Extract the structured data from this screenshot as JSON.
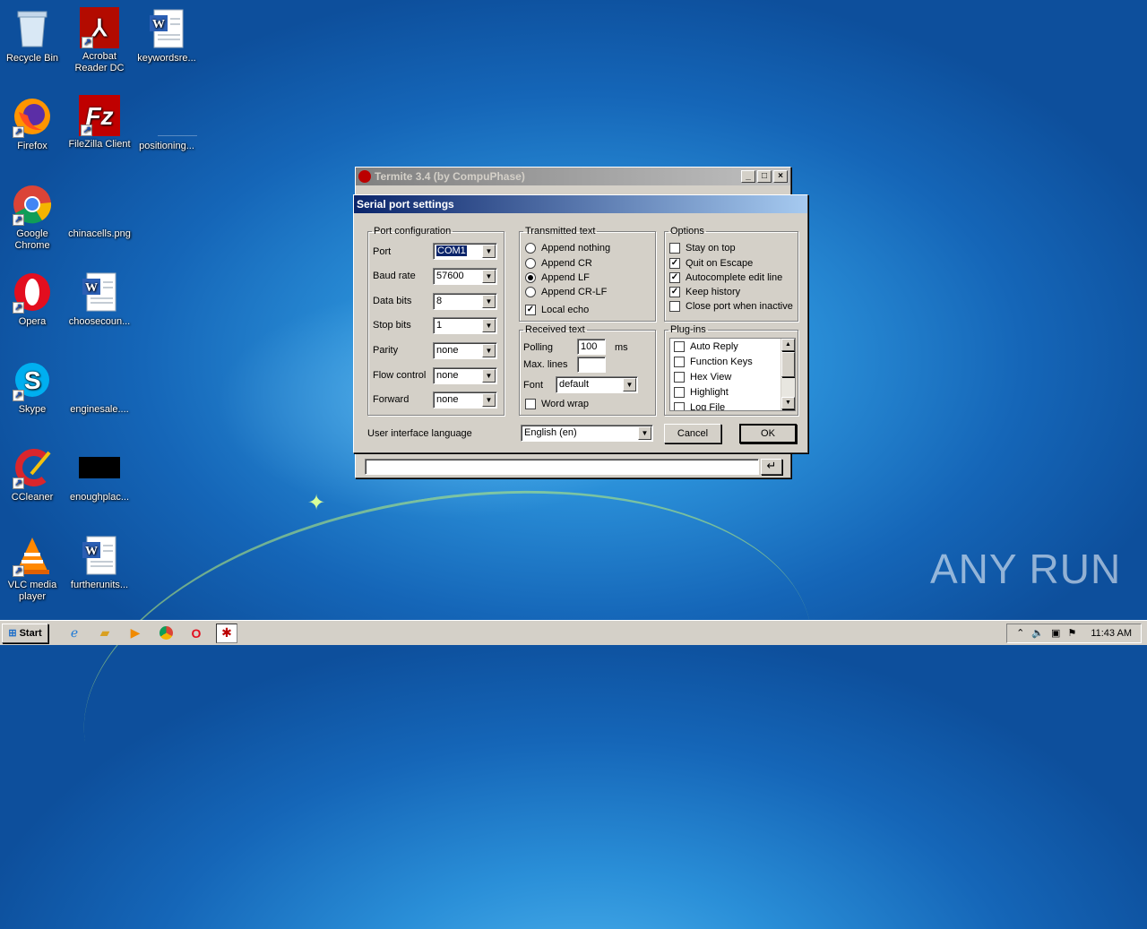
{
  "desktop_icons": [
    {
      "label": "Recycle Bin",
      "icon": "recycle-bin-icon"
    },
    {
      "label": "Acrobat Reader DC",
      "icon": "acrobat-icon"
    },
    {
      "label": "keywordsre...",
      "icon": "word-doc-icon"
    },
    {
      "label": "Firefox",
      "icon": "firefox-icon"
    },
    {
      "label": "FileZilla Client",
      "icon": "filezilla-icon"
    },
    {
      "label": "positioning...",
      "icon": "file-icon"
    },
    {
      "label": "Google Chrome",
      "icon": "chrome-icon"
    },
    {
      "label": "chinacells.png",
      "icon": "image-file-icon"
    },
    {
      "label": "Opera",
      "icon": "opera-icon"
    },
    {
      "label": "choosecoun...",
      "icon": "word-doc-icon"
    },
    {
      "label": "Skype",
      "icon": "skype-icon"
    },
    {
      "label": "enginesale....",
      "icon": "file-icon"
    },
    {
      "label": "CCleaner",
      "icon": "ccleaner-icon"
    },
    {
      "label": "enoughplac...",
      "icon": "black-image-icon"
    },
    {
      "label": "VLC media player",
      "icon": "vlc-icon"
    },
    {
      "label": "furtherunits...",
      "icon": "word-doc-icon"
    }
  ],
  "termite": {
    "title": "Termite 3.4 (by CompuPhase)",
    "send_icon": "enter-arrow-icon"
  },
  "dialog": {
    "title": "Serial port settings",
    "port_config": {
      "legend": "Port configuration",
      "rows": [
        {
          "label": "Port",
          "value": "COM1"
        },
        {
          "label": "Baud rate",
          "value": "57600"
        },
        {
          "label": "Data bits",
          "value": "8"
        },
        {
          "label": "Stop bits",
          "value": "1"
        },
        {
          "label": "Parity",
          "value": "none"
        },
        {
          "label": "Flow control",
          "value": "none"
        },
        {
          "label": "Forward",
          "value": "none"
        }
      ]
    },
    "transmitted": {
      "legend": "Transmitted text",
      "options": [
        "Append nothing",
        "Append CR",
        "Append LF",
        "Append CR-LF"
      ],
      "selected": "Append LF",
      "local_echo": "Local echo",
      "local_echo_checked": true
    },
    "received": {
      "legend": "Received text",
      "polling_label": "Polling",
      "polling_value": "100",
      "polling_unit": "ms",
      "max_lines_label": "Max. lines",
      "max_lines_value": "",
      "font_label": "Font",
      "font_value": "default",
      "word_wrap": "Word wrap",
      "word_wrap_checked": false
    },
    "options": {
      "legend": "Options",
      "items": [
        {
          "label": "Stay on top",
          "checked": false
        },
        {
          "label": "Quit on Escape",
          "checked": true
        },
        {
          "label": "Autocomplete edit line",
          "checked": true
        },
        {
          "label": "Keep history",
          "checked": true
        },
        {
          "label": "Close port when inactive",
          "checked": false
        }
      ]
    },
    "plugins": {
      "legend": "Plug-ins",
      "items": [
        {
          "label": "Auto Reply",
          "checked": false
        },
        {
          "label": "Function Keys",
          "checked": false
        },
        {
          "label": "Hex View",
          "checked": false
        },
        {
          "label": "Highlight",
          "checked": false
        },
        {
          "label": "Log File",
          "checked": false
        }
      ]
    },
    "language_label": "User interface language",
    "language_value": "English (en)",
    "cancel": "Cancel",
    "ok": "OK"
  },
  "taskbar": {
    "start": "Start",
    "clock": "11:43 AM",
    "pinned": [
      "ie-icon",
      "explorer-icon",
      "media-player-icon",
      "chrome-icon",
      "opera-icon",
      "termite-icon"
    ]
  },
  "watermark": "ANY RUN"
}
